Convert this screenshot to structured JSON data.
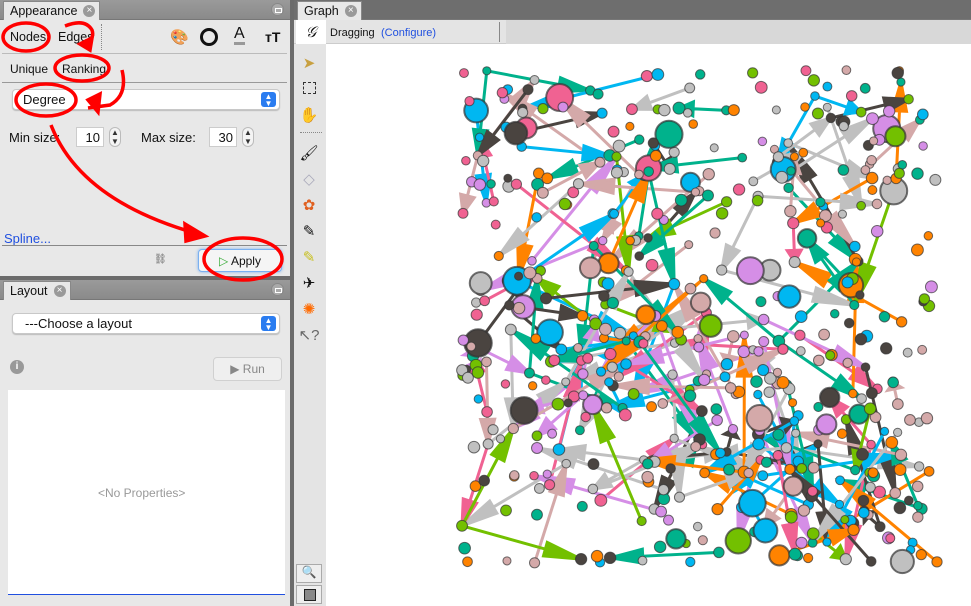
{
  "appearance": {
    "tab_label": "Appearance",
    "target_tabs": [
      "Nodes",
      "Edges"
    ],
    "mode_tabs": [
      "Unique",
      "Ranking"
    ],
    "attribute_select": "Degree",
    "min_size_label": "Min size:",
    "min_size": "10",
    "max_size_label": "Max size:",
    "max_size": "30",
    "spline_link": "Spline...",
    "apply_label": "Apply",
    "property_icons": [
      "palette-icon",
      "size-icon",
      "label-color-icon",
      "label-size-icon"
    ]
  },
  "layout": {
    "tab_label": "Layout",
    "select": "---Choose a layout",
    "run_label": "Run",
    "no_properties": "<No Properties>"
  },
  "graph": {
    "tab_label": "Graph",
    "tool_label": "Dragging",
    "configure_link": "(Configure)",
    "tools": [
      "select-icon",
      "rectangle-select-icon",
      "hand-icon",
      "paintbrush-icon",
      "diamond-icon",
      "color-wheel-icon",
      "pencil-icon",
      "highlighter-icon",
      "airplane-icon",
      "gear-icon",
      "help-cursor-icon"
    ],
    "node_colors": [
      "#00b7f1",
      "#ff8300",
      "#73c000",
      "#f06292",
      "#d58ee6",
      "#c0c0c0",
      "#d4a9a9",
      "#00b28c",
      "#4a4440"
    ]
  },
  "colors": {
    "annotation": "#ff0000",
    "link": "#2050e0",
    "select_accent": "#2a7cf0"
  }
}
